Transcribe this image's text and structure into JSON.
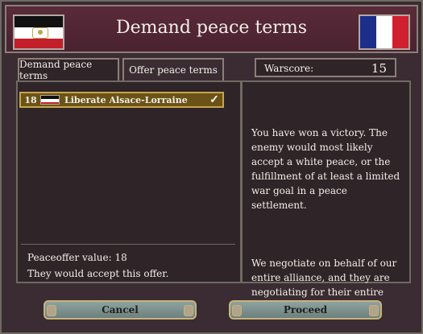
{
  "dialog": {
    "title": "Demand peace terms",
    "tabs": [
      {
        "label": "Demand peace terms",
        "active": true
      },
      {
        "label": "Offer peace terms",
        "active": false
      }
    ],
    "warscore": {
      "label": "Warscore:",
      "value": "15"
    }
  },
  "flags": {
    "left_icon": "german-empire-flag-icon",
    "right_icon": "france-flag-icon"
  },
  "war_goals": [
    {
      "cost": "18",
      "icon": "small-german-flag-icon",
      "label": "Liberate Alsace-Lorraine",
      "selected": true
    }
  ],
  "peace": {
    "offer_value_label": "Peaceoffer value: 18",
    "acceptance_text": "They would accept this offer."
  },
  "info": {
    "paragraphs": [
      "You have won a victory. The enemy would most likely accept a white peace, or the fulfillment of at least a limited war goal in a peace settlement.",
      "We negotiate on behalf of our entire alliance, and they are negotiating for their entire alliance."
    ]
  },
  "buttons": {
    "cancel": "Cancel",
    "proceed": "Proceed"
  }
}
